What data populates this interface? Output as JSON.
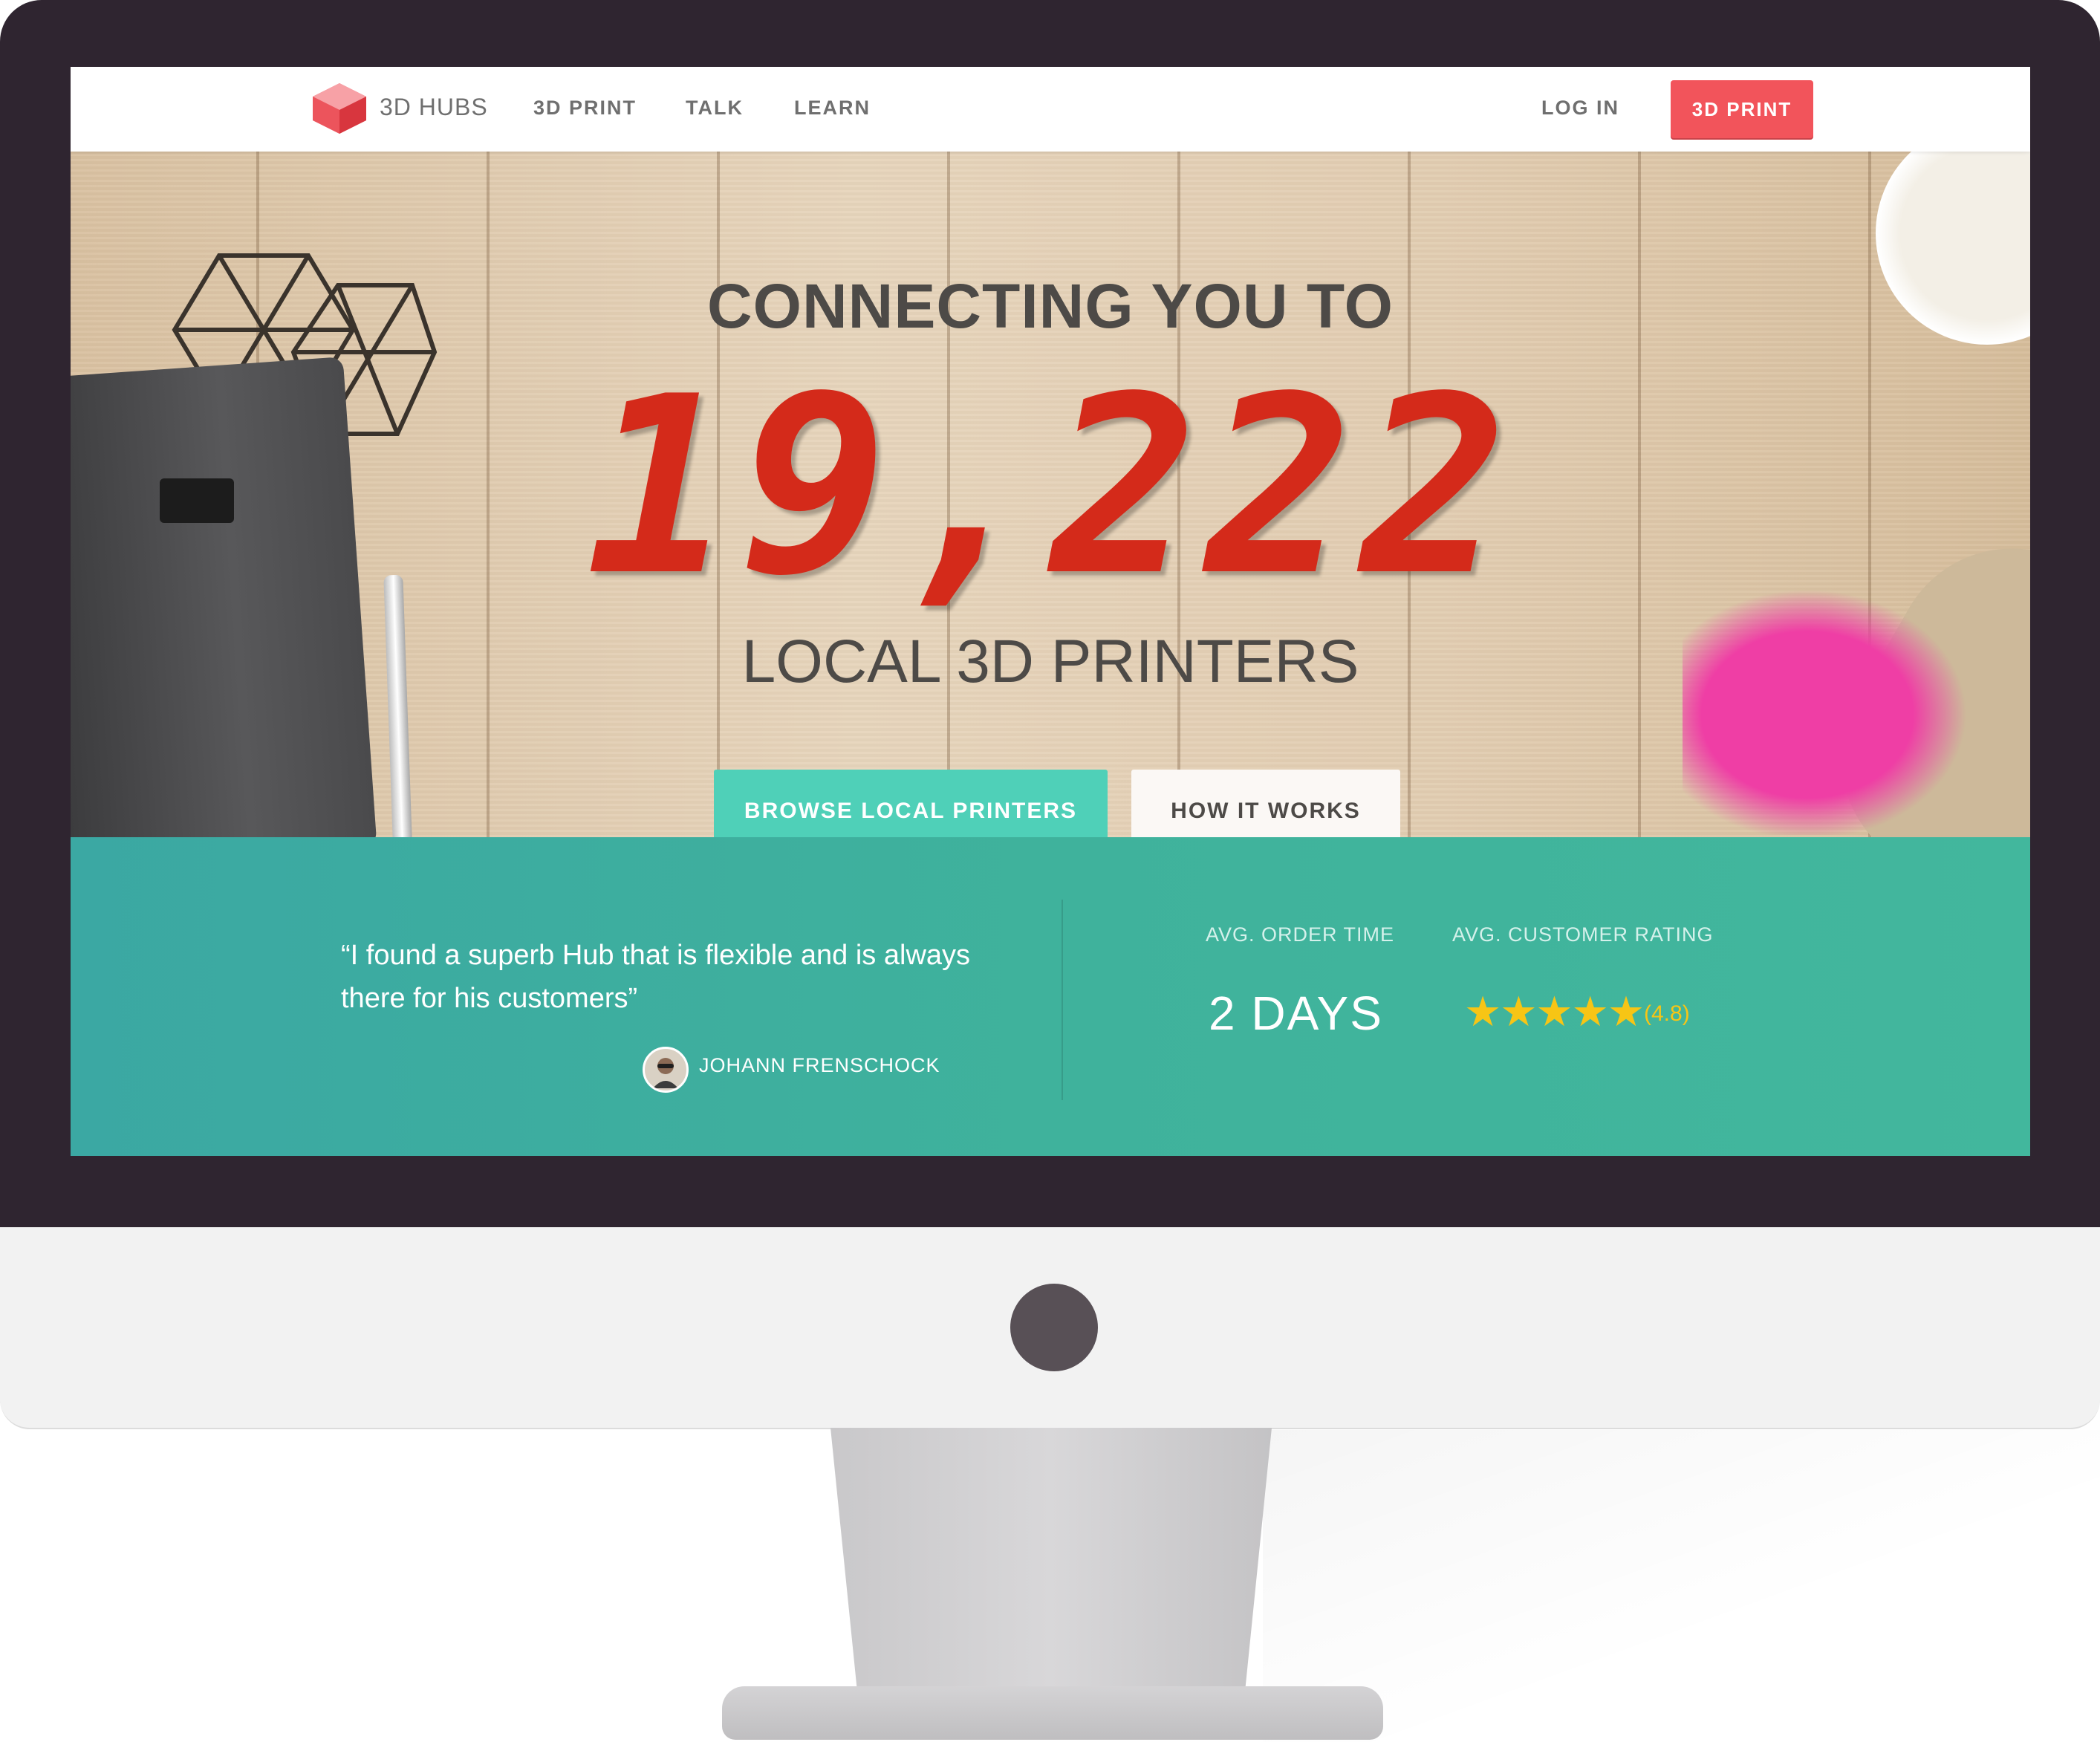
{
  "brand": {
    "name": "3D HUBS",
    "logo_icon": "hub-cube-icon",
    "accent": "#f2545b"
  },
  "nav": {
    "items": [
      "3D PRINT",
      "TALK",
      "LEARN"
    ],
    "login": "LOG IN",
    "cta": "3D PRINT"
  },
  "hero": {
    "title_top": "CONNECTING YOU TO",
    "counter": "19,222",
    "title_bottom": "LOCAL 3D PRINTERS",
    "primary_button": "BROWSE LOCAL PRINTERS",
    "secondary_button": "HOW IT WORKS",
    "counter_color": "#d42a1a",
    "primary_color": "#4fd0b8"
  },
  "testimonial": {
    "quote": "“I found a superb Hub that is flexible and is always there for his customers”",
    "author": "JOHANN FRENSCHOCK",
    "band_color": "#3fb29c"
  },
  "stats": {
    "order_time_label": "AVG. ORDER TIME",
    "order_time_value": "2 DAYS",
    "rating_label": "AVG. CUSTOMER RATING",
    "rating_stars": "★★★★★",
    "rating_value": "(4.8)",
    "star_color": "#f7c515"
  }
}
